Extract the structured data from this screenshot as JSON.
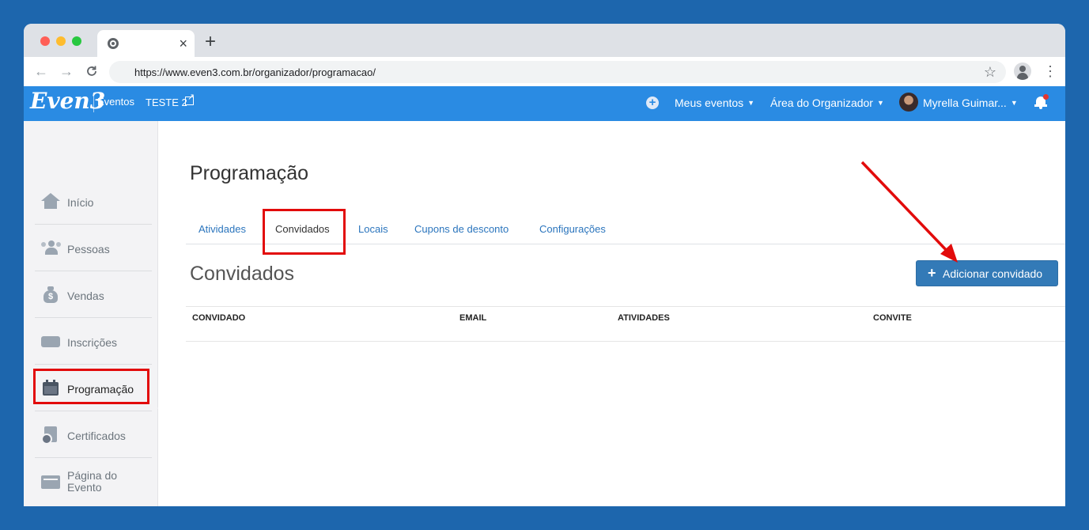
{
  "browser": {
    "url": "https://www.even3.com.br/organizador/programacao/",
    "tab_close": "×",
    "new_tab": "+",
    "back": "←",
    "forward": "→",
    "reload": "C",
    "star": "☆",
    "menu": "⋮"
  },
  "header": {
    "logo": "Even3",
    "section": "Eventos",
    "event_name": "TESTE 2",
    "add_icon": "+",
    "menus": [
      {
        "label": "Meus eventos"
      },
      {
        "label": "Área do Organizador"
      },
      {
        "label": "Myrella Guimar..."
      }
    ],
    "caret": "▼"
  },
  "sidebar": {
    "items": [
      {
        "label": "Início",
        "icon": "home-icon"
      },
      {
        "label": "Pessoas",
        "icon": "people-icon"
      },
      {
        "label": "Vendas",
        "icon": "money-bag-icon"
      },
      {
        "label": "Inscrições",
        "icon": "ticket-icon"
      },
      {
        "label": "Programação",
        "icon": "calendar-icon"
      },
      {
        "label": "Certificados",
        "icon": "certificate-icon"
      },
      {
        "label": "Página do Evento",
        "icon": "page-icon"
      }
    ]
  },
  "main": {
    "page_title": "Programação",
    "tabs": [
      {
        "label": "Atividades"
      },
      {
        "label": "Convidados"
      },
      {
        "label": "Locais"
      },
      {
        "label": "Cupons de desconto"
      },
      {
        "label": "Configurações"
      }
    ],
    "section_title": "Convidados",
    "add_button": {
      "icon": "+",
      "label": "Adicionar convidado"
    },
    "table": {
      "columns": [
        "CONVIDADO",
        "EMAIL",
        "ATIVIDADES",
        "CONVITE"
      ]
    }
  },
  "colors": {
    "background": "#1d66ad",
    "header": "#2a8be3",
    "button": "#337ab7",
    "annotation": "#e20b0b"
  }
}
